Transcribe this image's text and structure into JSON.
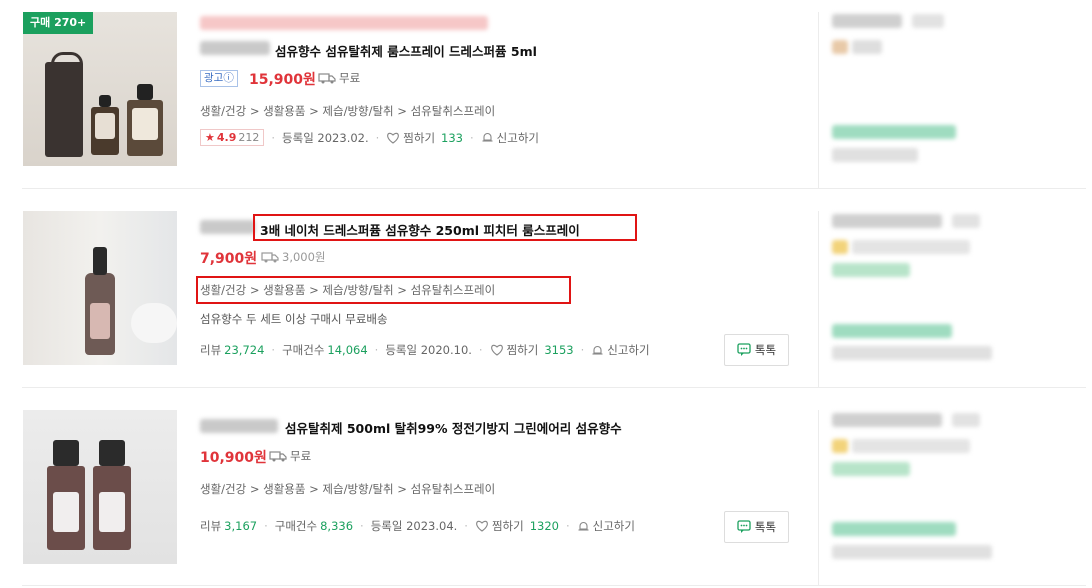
{
  "products": [
    {
      "purchase_badge": "구매 270+",
      "title": "섬유향수 섬유탈취제 룸스프레이 드레스퍼퓸 5ml",
      "ad_label": "광고ⓘ",
      "price": "15,900원",
      "shipping": "무료",
      "category": "생활/건강 > 생활용품 > 제습/방향/탈취 > 섬유탈취스프레이",
      "rating": "4.9",
      "rating_count": "212",
      "registered": "등록일 2023.02.",
      "wish_label": "찜하기",
      "wish_count": "133",
      "report_label": "신고하기"
    },
    {
      "title": "3배 네이처 드레스퍼퓸 섬유향수 250ml 피치터 룸스프레이",
      "price": "7,900원",
      "shipping": "3,000원",
      "category": "생활/건강 > 생활용품 > 제습/방향/탈취 > 섬유탈취스프레이",
      "description": "섬유향수 두 세트 이상 구매시 무료배송",
      "review_label": "리뷰",
      "review_count": "23,724",
      "purchase_label": "구매건수",
      "purchase_count": "14,064",
      "registered": "등록일 2020.10.",
      "wish_label": "찜하기",
      "wish_count": "3153",
      "report_label": "신고하기",
      "talk_label": "톡톡"
    },
    {
      "title": "섬유탈취제 500ml 탈취99% 정전기방지 그린에어리 섬유향수",
      "price": "10,900원",
      "shipping": "무료",
      "category": "생활/건강 > 생활용품 > 제습/방향/탈취 > 섬유탈취스프레이",
      "review_label": "리뷰",
      "review_count": "3,167",
      "purchase_label": "구매건수",
      "purchase_count": "8,336",
      "registered": "등록일 2023.04.",
      "wish_label": "찜하기",
      "wish_count": "1320",
      "report_label": "신고하기",
      "talk_label": "톡톡"
    }
  ],
  "colors": {
    "accent_green": "#1ba05e",
    "price_red": "#e0343a",
    "highlight_red": "#e01414"
  }
}
